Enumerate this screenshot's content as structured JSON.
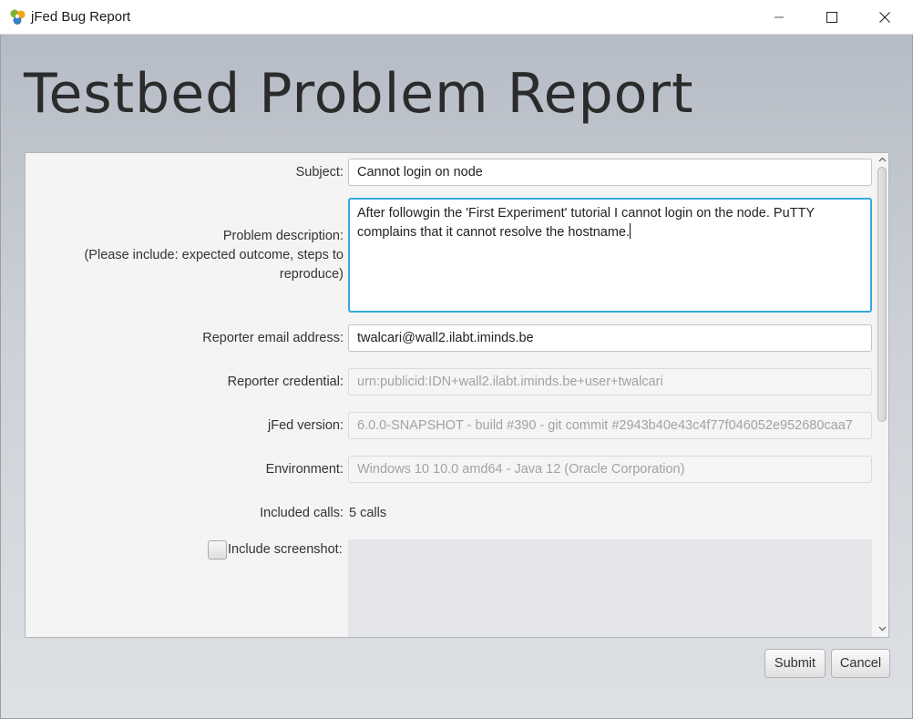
{
  "window": {
    "title": "jFed Bug Report",
    "icons": [
      "jfed-logo-icon",
      "minimize-icon",
      "maximize-icon",
      "close-icon"
    ]
  },
  "page": {
    "title": "Testbed Problem Report"
  },
  "form": {
    "subject": {
      "label": "Subject:",
      "value": "Cannot login on node"
    },
    "description": {
      "label_lines": [
        "Problem description:",
        "(Please include: expected outcome, steps to",
        "reproduce)"
      ],
      "value_lines": [
        "After followgin the 'First Experiment' tutorial I cannot login on the node. PuTTY",
        "complains that it cannot resolve the hostname."
      ]
    },
    "email": {
      "label": "Reporter email address:",
      "value": "twalcari@wall2.ilabt.iminds.be"
    },
    "credential": {
      "label": "Reporter credential:",
      "value": "urn:publicid:IDN+wall2.ilabt.iminds.be+user+twalcari"
    },
    "version": {
      "label": "jFed version:",
      "value": "6.0.0-SNAPSHOT  - build #390  - git commit #2943b40e43c4f77f046052e952680caa7"
    },
    "environment": {
      "label": "Environment:",
      "value": "Windows 10 10.0 amd64 - Java 12 (Oracle Corporation)"
    },
    "calls": {
      "label": "Included calls:",
      "value": "5 calls"
    },
    "screenshot": {
      "label": "Include screenshot:",
      "checked": false
    }
  },
  "buttons": {
    "submit": "Submit",
    "cancel": "Cancel"
  },
  "colors": {
    "focus_border": "#39a9dc",
    "background_top": "#b6bcc6",
    "background_bottom": "#dde0e4"
  }
}
